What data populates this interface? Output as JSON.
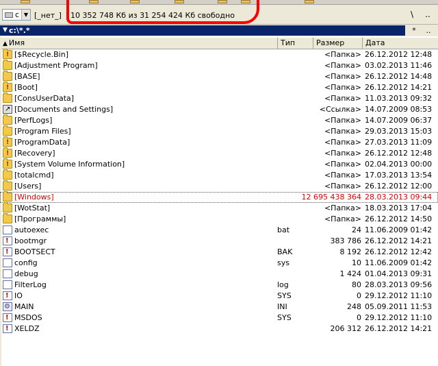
{
  "drive": {
    "letter": "c",
    "volume_label": "[_нет_]",
    "free_space": "10 352 748 Кб из 31 254 424 Кб свободно"
  },
  "nav": {
    "root_btn": "\\",
    "up_btn": "..",
    "star_btn": "*"
  },
  "path": {
    "text": "c:\\*.*"
  },
  "columns": {
    "name": "Имя",
    "ext": "Тип",
    "size": "Размер",
    "date": "Дата"
  },
  "files": [
    {
      "icon": "folder-system",
      "name": "[$Recycle.Bin]",
      "ext": "",
      "size": "<Папка>",
      "date": "26.12.2012 12:48"
    },
    {
      "icon": "folder",
      "name": "[Adjustment Program]",
      "ext": "",
      "size": "<Папка>",
      "date": "03.02.2013 11:46"
    },
    {
      "icon": "folder",
      "name": "[BASE]",
      "ext": "",
      "size": "<Папка>",
      "date": "26.12.2012 14:48"
    },
    {
      "icon": "folder-system",
      "name": "[Boot]",
      "ext": "",
      "size": "<Папка>",
      "date": "26.12.2012 14:21"
    },
    {
      "icon": "folder",
      "name": "[ConsUserData]",
      "ext": "",
      "size": "<Папка>",
      "date": "11.03.2013 09:32"
    },
    {
      "icon": "link",
      "name": "[Documents and Settings]",
      "ext": "",
      "size": "<Ссылка>",
      "date": "14.07.2009 08:53"
    },
    {
      "icon": "folder",
      "name": "[PerfLogs]",
      "ext": "",
      "size": "<Папка>",
      "date": "14.07.2009 06:37"
    },
    {
      "icon": "folder",
      "name": "[Program Files]",
      "ext": "",
      "size": "<Папка>",
      "date": "29.03.2013 15:03"
    },
    {
      "icon": "folder-system",
      "name": "[ProgramData]",
      "ext": "",
      "size": "<Папка>",
      "date": "27.03.2013 11:09"
    },
    {
      "icon": "folder-system",
      "name": "[Recovery]",
      "ext": "",
      "size": "<Папка>",
      "date": "26.12.2012 12:48"
    },
    {
      "icon": "folder-system",
      "name": "[System Volume Information]",
      "ext": "",
      "size": "<Папка>",
      "date": "02.04.2013 00:00"
    },
    {
      "icon": "folder",
      "name": "[totalcmd]",
      "ext": "",
      "size": "<Папка>",
      "date": "17.03.2013 13:54"
    },
    {
      "icon": "folder",
      "name": "[Users]",
      "ext": "",
      "size": "<Папка>",
      "date": "26.12.2012 12:00"
    },
    {
      "icon": "folder",
      "name": "[Windows]",
      "ext": "",
      "size": "12 695 438 364",
      "date": "28.03.2013 09:44",
      "selected": true
    },
    {
      "icon": "folder",
      "name": "[WotStat]",
      "ext": "",
      "size": "<Папка>",
      "date": "18.03.2013 17:04"
    },
    {
      "icon": "folder",
      "name": "[Программы]",
      "ext": "",
      "size": "<Папка>",
      "date": "26.12.2012 14:50"
    },
    {
      "icon": "file",
      "name": "autoexec",
      "ext": "bat",
      "size": "24",
      "date": "11.06.2009 01:42"
    },
    {
      "icon": "file-system",
      "name": "bootmgr",
      "ext": "",
      "size": "383 786",
      "date": "26.12.2012 14:21"
    },
    {
      "icon": "file-system",
      "name": "BOOTSECT",
      "ext": "BAK",
      "size": "8 192",
      "date": "26.12.2012 12:42"
    },
    {
      "icon": "file",
      "name": "config",
      "ext": "sys",
      "size": "10",
      "date": "11.06.2009 01:42"
    },
    {
      "icon": "file",
      "name": "debug",
      "ext": "",
      "size": "1 424",
      "date": "01.04.2013 09:31"
    },
    {
      "icon": "file",
      "name": "FilterLog",
      "ext": "log",
      "size": "80",
      "date": "28.03.2013 09:56"
    },
    {
      "icon": "file-system",
      "name": "IO",
      "ext": "SYS",
      "size": "0",
      "date": "29.12.2012 11:10"
    },
    {
      "icon": "config",
      "name": "MAIN",
      "ext": "INI",
      "size": "248",
      "date": "05.09.2011 11:53"
    },
    {
      "icon": "file-system",
      "name": "MSDOS",
      "ext": "SYS",
      "size": "0",
      "date": "29.12.2012 11:10"
    },
    {
      "icon": "file-system",
      "name": "XELDZ",
      "ext": "",
      "size": "206 312",
      "date": "26.12.2012 14:21"
    }
  ],
  "colors": {
    "selected_text": "#e00000",
    "path_bg": "#0a246a",
    "annotation": "#ff0000"
  }
}
